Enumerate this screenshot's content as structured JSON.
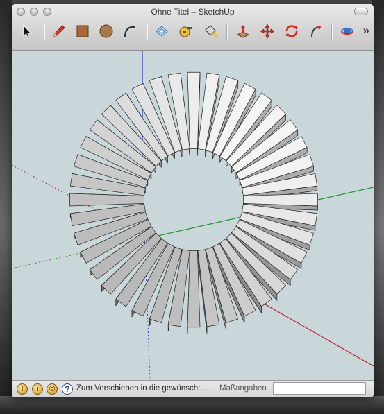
{
  "window": {
    "title": "Ohne Titel – SketchUp"
  },
  "toolbar": {
    "tools": [
      {
        "name": "select-tool",
        "icon": "arrow-cursor-icon"
      },
      {
        "name": "pencil-tool",
        "icon": "pencil-icon"
      },
      {
        "name": "rectangle-tool",
        "icon": "rectangle-icon"
      },
      {
        "name": "circle-tool",
        "icon": "circle-icon"
      },
      {
        "name": "arc-tool",
        "icon": "arc-icon"
      },
      {
        "name": "make-component-tool",
        "icon": "component-icon"
      },
      {
        "name": "tape-measure-tool",
        "icon": "tape-measure-icon"
      },
      {
        "name": "paint-bucket-tool",
        "icon": "paint-bucket-icon"
      },
      {
        "name": "push-pull-tool",
        "icon": "push-pull-icon"
      },
      {
        "name": "move-tool",
        "icon": "move-icon"
      },
      {
        "name": "rotate-tool",
        "icon": "rotate-icon"
      },
      {
        "name": "follow-me-tool",
        "icon": "follow-me-icon"
      },
      {
        "name": "orbit-tool",
        "icon": "orbit-icon"
      }
    ],
    "overflow_label": "»"
  },
  "statusbar": {
    "status_text": "Zum Verschieben in die gewünscht...",
    "help_label": "?",
    "measurements_label": "Maßangaben",
    "measurements_value": ""
  },
  "colors": {
    "viewport_bg": "#c9d6da",
    "axis_red": "#c0262d",
    "axis_green": "#1f9a2b",
    "axis_blue": "#2a3cc8"
  }
}
